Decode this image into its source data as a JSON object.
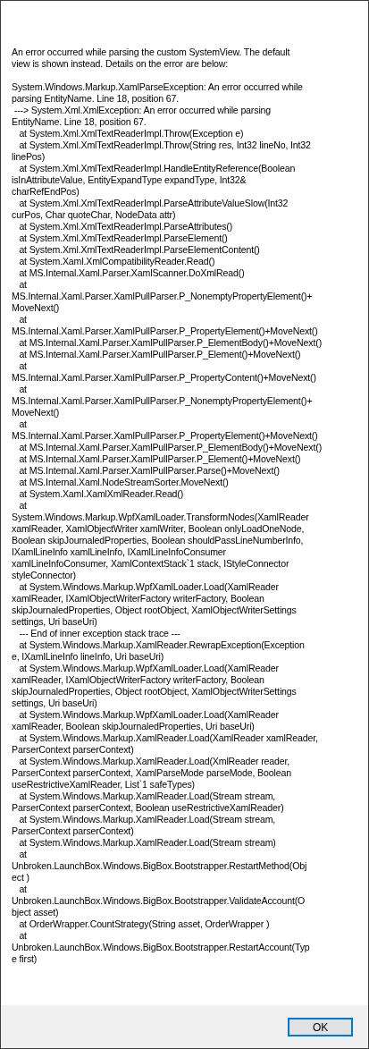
{
  "message": [
    "An error occurred while parsing the custom SystemView. The default",
    "view is shown instead. Details on the error are below:"
  ],
  "details": [
    "System.Windows.Markup.XamlParseException: An error occurred while",
    "parsing EntityName. Line 18, position 67.",
    " ---> System.Xml.XmlException: An error occurred while parsing",
    "EntityName. Line 18, position 67.",
    "   at System.Xml.XmlTextReaderImpl.Throw(Exception e)",
    "   at System.Xml.XmlTextReaderImpl.Throw(String res, Int32 lineNo, Int32",
    "linePos)",
    "   at System.Xml.XmlTextReaderImpl.HandleEntityReference(Boolean",
    "isInAttributeValue, EntityExpandType expandType, Int32&",
    "charRefEndPos)",
    "   at System.Xml.XmlTextReaderImpl.ParseAttributeValueSlow(Int32",
    "curPos, Char quoteChar, NodeData attr)",
    "   at System.Xml.XmlTextReaderImpl.ParseAttributes()",
    "   at System.Xml.XmlTextReaderImpl.ParseElement()",
    "   at System.Xml.XmlTextReaderImpl.ParseElementContent()",
    "   at System.Xaml.XmlCompatibilityReader.Read()",
    "   at MS.Internal.Xaml.Parser.XamlScanner.DoXmlRead()",
    "   at",
    "MS.Internal.Xaml.Parser.XamlPullParser.P_NonemptyPropertyElement()+",
    "MoveNext()",
    "   at",
    "MS.Internal.Xaml.Parser.XamlPullParser.P_PropertyElement()+MoveNext()",
    "   at MS.Internal.Xaml.Parser.XamlPullParser.P_ElementBody()+MoveNext()",
    "   at MS.Internal.Xaml.Parser.XamlPullParser.P_Element()+MoveNext()",
    "   at",
    "MS.Internal.Xaml.Parser.XamlPullParser.P_PropertyContent()+MoveNext()",
    "   at",
    "MS.Internal.Xaml.Parser.XamlPullParser.P_NonemptyPropertyElement()+",
    "MoveNext()",
    "   at",
    "MS.Internal.Xaml.Parser.XamlPullParser.P_PropertyElement()+MoveNext()",
    "   at MS.Internal.Xaml.Parser.XamlPullParser.P_ElementBody()+MoveNext()",
    "   at MS.Internal.Xaml.Parser.XamlPullParser.P_Element()+MoveNext()",
    "   at MS.Internal.Xaml.Parser.XamlPullParser.Parse()+MoveNext()",
    "   at MS.Internal.Xaml.NodeStreamSorter.MoveNext()",
    "   at System.Xaml.XamlXmlReader.Read()",
    "   at",
    "System.Windows.Markup.WpfXamlLoader.TransformNodes(XamlReader",
    "xamlReader, XamlObjectWriter xamlWriter, Boolean onlyLoadOneNode,",
    "Boolean skipJournaledProperties, Boolean shouldPassLineNumberInfo,",
    "IXamlLineInfo xamlLineInfo, IXamlLineInfoConsumer",
    "xamlLineInfoConsumer, XamlContextStack`1 stack, IStyleConnector",
    "styleConnector)",
    "   at System.Windows.Markup.WpfXamlLoader.Load(XamlReader",
    "xamlReader, IXamlObjectWriterFactory writerFactory, Boolean",
    "skipJournaledProperties, Object rootObject, XamlObjectWriterSettings",
    "settings, Uri baseUri)",
    "   --- End of inner exception stack trace ---",
    "   at System.Windows.Markup.XamlReader.RewrapException(Exception",
    "e, IXamlLineInfo lineInfo, Uri baseUri)",
    "   at System.Windows.Markup.WpfXamlLoader.Load(XamlReader",
    "xamlReader, IXamlObjectWriterFactory writerFactory, Boolean",
    "skipJournaledProperties, Object rootObject, XamlObjectWriterSettings",
    "settings, Uri baseUri)",
    "   at System.Windows.Markup.WpfXamlLoader.Load(XamlReader",
    "xamlReader, Boolean skipJournaledProperties, Uri baseUri)",
    "   at System.Windows.Markup.XamlReader.Load(XamlReader xamlReader,",
    "ParserContext parserContext)",
    "   at System.Windows.Markup.XamlReader.Load(XmlReader reader,",
    "ParserContext parserContext, XamlParseMode parseMode, Boolean",
    "useRestrictiveXamlReader, List`1 safeTypes)",
    "   at System.Windows.Markup.XamlReader.Load(Stream stream,",
    "ParserContext parserContext, Boolean useRestrictiveXamlReader)",
    "   at System.Windows.Markup.XamlReader.Load(Stream stream,",
    "ParserContext parserContext)",
    "   at System.Windows.Markup.XamlReader.Load(Stream stream)",
    "   at",
    "Unbroken.LaunchBox.Windows.BigBox.Bootstrapper.RestartMethod(Obj",
    "ect )",
    "   at",
    "Unbroken.LaunchBox.Windows.BigBox.Bootstrapper.ValidateAccount(O",
    "bject asset)",
    "   at OrderWrapper.CountStrategy(String asset, OrderWrapper )",
    "   at",
    "Unbroken.LaunchBox.Windows.BigBox.Bootstrapper.RestartAccount(Typ",
    "e first)"
  ],
  "buttons": [
    {
      "label": "OK",
      "focused": true
    }
  ]
}
